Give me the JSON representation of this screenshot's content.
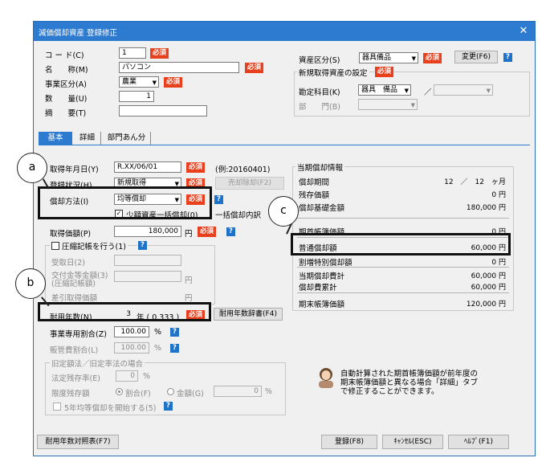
{
  "window": {
    "title": "減価償却資産 登録修正"
  },
  "required_label": "必須",
  "help_label": "?",
  "left_fields": {
    "code": {
      "label": "コ ー ド(C)",
      "value": "1"
    },
    "name": {
      "label": "名　　称(M)",
      "value": "パソコン"
    },
    "division": {
      "label": "事業区分(A)",
      "value": "農業"
    },
    "quantity": {
      "label": "数　　量(U)",
      "value": "1"
    },
    "summary": {
      "label": "摘　　要(T)",
      "value": ""
    }
  },
  "right_fields": {
    "asset_class": {
      "label": "資産区分(S)",
      "value": "器具備品"
    },
    "change_button": "変更(F6)",
    "new_group_title": "新規取得資産の設定",
    "account": {
      "label": "勘定科目(K)",
      "value": "器具　備品",
      "sep": "／"
    },
    "department": {
      "label": "部　　門(B)"
    }
  },
  "tabs": [
    {
      "label": "基本",
      "active": true
    },
    {
      "label": "詳細",
      "active": false
    },
    {
      "label": "部門あん分",
      "active": false
    }
  ],
  "basic": {
    "acq_date": {
      "label": "取得年月日(Y)",
      "value": "R.XX/06/01",
      "example": "(例:20160401)"
    },
    "reg_status": {
      "label": "登録状況(H)",
      "value": "新規取得",
      "button": "売却除却(F2)"
    },
    "method": {
      "label": "償却方法(I)",
      "value": "均等償却"
    },
    "small_asset": {
      "label": "少額資産一括償却(0)",
      "checked": "✓"
    },
    "lump_note": "一括償却内訳",
    "acq_price": {
      "label": "取得価額(P)",
      "value": "180,000",
      "unit": "円"
    },
    "compression": {
      "label": "圧縮記帳を行う(1)"
    },
    "receipt_date": {
      "label": "受取日(2)"
    },
    "grant": {
      "label": "交付金等金額(3)",
      "label2": "(圧縮記帳額)",
      "unit": "円"
    },
    "after_price": {
      "label": "差引取得価額",
      "unit": "円"
    },
    "life": {
      "label": "耐用年数(N)",
      "value": "3",
      "rate": "年 ( 0.333 )"
    },
    "life_button": "耐用年数辞書(F4)",
    "business_ratio": {
      "label": "事業専用割合(Z)",
      "value": "100.00",
      "unit": "%"
    },
    "sales_ratio": {
      "label": "販管費割合(L)",
      "value": "100.00",
      "unit": "%"
    },
    "old_group_title": "旧定額法／旧定率法の場合",
    "legal_rate": {
      "label": "法定残存率(E)",
      "value": "0",
      "unit": "%"
    },
    "limit": {
      "label": "限度残存額",
      "opt1": "割合(F)",
      "opt2": "金額(G)",
      "value": "0",
      "unit": "%"
    },
    "five_year": {
      "label": "5年均等償却を開始する(5)"
    }
  },
  "depr_info": {
    "title": "当期償却情報",
    "rows": [
      {
        "label": "償却期間",
        "value": "12　／　12　ヶ月"
      },
      {
        "label": "残存価額",
        "value": "0 円"
      },
      {
        "label": "償却基礎金額",
        "value": "180,000 円"
      },
      {
        "label": "期首帳簿価額",
        "value": "0 円"
      },
      {
        "label": "普通償却額",
        "value": "60,000 円"
      },
      {
        "label": "割増特別償却額",
        "value": "0 円"
      },
      {
        "label": "当期償却費計",
        "value": "60,000 円"
      },
      {
        "label": "償却費累計",
        "value": "60,000 円"
      },
      {
        "label": "期末帳簿価額",
        "value": "120,000 円"
      }
    ]
  },
  "info_message": {
    "line1": "自動計算された期首帳簿価額が前年度の",
    "line2": "期末帳簿価額と異なる場合「詳細」タブ",
    "line3": "で修正することができます。"
  },
  "footer": {
    "life_table": "耐用年数対照表(F7)",
    "register": "登録(F8)",
    "cancel": "ｷｬﾝｾﾙ(ESC)",
    "help": "ﾍﾙﾌﾟ(F1)"
  },
  "callouts": {
    "a": "a",
    "b": "b",
    "c": "c"
  },
  "colors": {
    "titlebar": "#2d7bd0",
    "required": "#e8401c",
    "help": "#1e72c8"
  }
}
